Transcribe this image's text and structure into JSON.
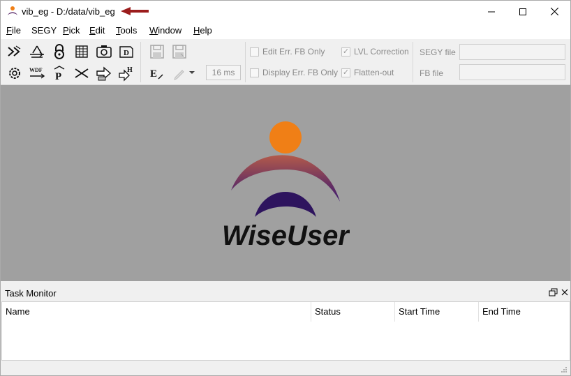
{
  "window": {
    "title": "vib_eg - D:/data/vib_eg",
    "icons": {
      "app": "wiseuser-app-icon",
      "arrow": "red-arrow-icon"
    }
  },
  "window_controls": [
    "minimize-icon",
    "maximize-icon",
    "close-icon"
  ],
  "menu": {
    "file": "File",
    "segy": "SEGY",
    "pick": "Pick",
    "edit": "Edit",
    "tools": "Tools",
    "window": "Window",
    "help": "Help",
    "underlines": [
      "F",
      "",
      "P",
      "E",
      "T",
      "W",
      "H"
    ]
  },
  "toolbar": {
    "row1_icons": [
      "fast-forward-icon",
      "import-arrow-icon",
      "lock-icon",
      "grid-table-icon",
      "camera-icon",
      "d-document-icon"
    ],
    "row2_icons": [
      "settings-gear-icon",
      "wdf-icon",
      "p-pick-icon",
      "scissors-cut-icon",
      "export-arrow-icon",
      "h-arrow-icon"
    ],
    "save_icons": [
      "save-disk-icon",
      "save-all-disk-icon"
    ],
    "edit_e_icon": "e-edit-icon",
    "pencil_icon": "pencil-icon",
    "dropdown_icon": "chevron-down-icon",
    "ms_value": "16 ms",
    "edit_err_fb_only": {
      "label": "Edit Err. FB Only",
      "checked": false
    },
    "display_err_fb_only": {
      "label": "Display Err. FB Only",
      "checked": false
    },
    "lvl_correction": {
      "label": "LVL Correction",
      "checked": true
    },
    "flatten_out": {
      "label": "Flatten-out",
      "checked": true
    },
    "segy_file_label": "SEGY file",
    "segy_file_value": "",
    "fb_file_label": "FB file",
    "fb_file_value": ""
  },
  "canvas": {
    "logo_text": "WiseUser",
    "colors": {
      "background": "#a0a0a0",
      "head": "#f07f16",
      "arc_top": "#b35a4a",
      "arc_bottom": "#3a1870"
    }
  },
  "task_monitor": {
    "title": "Task Monitor",
    "float_icon": "restore-float-icon",
    "close_icon": "close-icon",
    "columns": [
      "Name",
      "Status",
      "Start Time",
      "End Time"
    ],
    "rows": []
  },
  "statusbar": {
    "grip_icon": "resize-grip-icon"
  }
}
